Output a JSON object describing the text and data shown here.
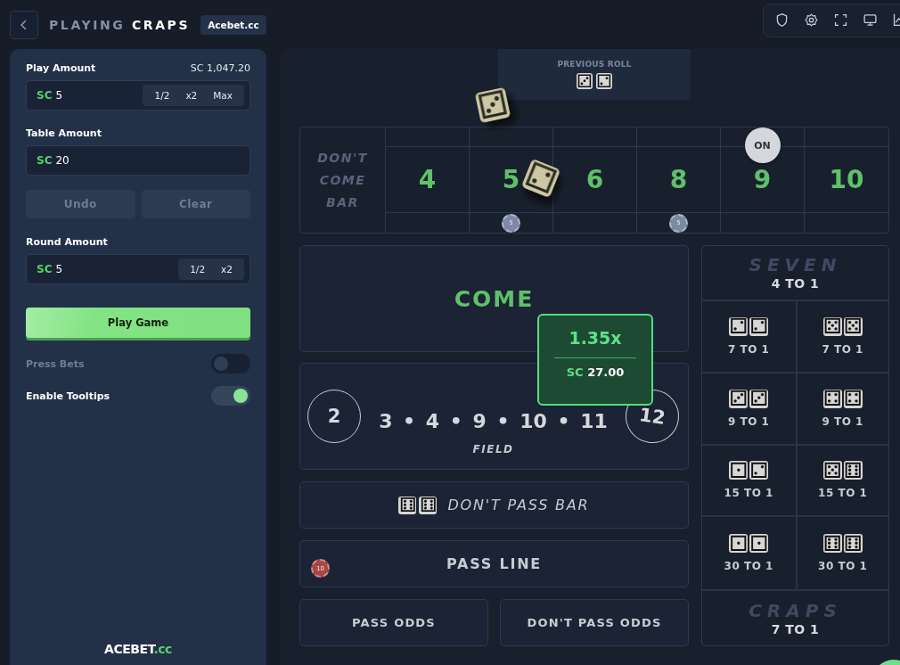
{
  "header": {
    "title_prefix": "PLAYING",
    "title": "CRAPS",
    "badge": "Acebet.cc"
  },
  "sidebar": {
    "play_amount": {
      "label": "Play Amount",
      "balance": "SC 1,047.20",
      "currency": "SC",
      "value": "5",
      "buttons": [
        "1/2",
        "x2",
        "Max"
      ]
    },
    "table_amount": {
      "label": "Table Amount",
      "currency": "SC",
      "value": "20"
    },
    "actions": [
      {
        "label": "Undo",
        "disabled": true
      },
      {
        "label": "Clear",
        "disabled": true
      }
    ],
    "round_amount": {
      "label": "Round Amount",
      "currency": "SC",
      "value": "5",
      "buttons": [
        "1/2",
        "x2"
      ]
    },
    "play_button": "Play Game",
    "toggles": [
      {
        "label": "Press Bets",
        "on": false,
        "disabled": true
      },
      {
        "label": "Enable Tooltips",
        "on": true,
        "disabled": false
      }
    ],
    "logo": {
      "name": "ACEBET",
      "suffix": ".cc"
    }
  },
  "previous_roll": {
    "label": "PREVIOUS ROLL",
    "dice": [
      "⚂",
      "⚁"
    ]
  },
  "rolling_dice": [
    "⚂",
    "⚁"
  ],
  "point_table": {
    "dont_come_bar": "DON'T COME BAR",
    "puck_label": "ON",
    "points": [
      {
        "number": "4",
        "on": false
      },
      {
        "number": "5",
        "on": false,
        "chip": {
          "value": "5",
          "color": "#7d8aa3"
        }
      },
      {
        "number": "6",
        "on": false
      },
      {
        "number": "8",
        "on": false,
        "chip": {
          "value": "5",
          "color": "#7d8aa3"
        }
      },
      {
        "number": "9",
        "on": true
      },
      {
        "number": "10",
        "on": false
      }
    ]
  },
  "come": "COME",
  "field": {
    "label": "FIELD",
    "numbers": "3 • 4 • 9 • 10 • 11",
    "circled": [
      "2",
      "12"
    ]
  },
  "dont_pass_bar": {
    "label": "DON'T PASS BAR",
    "dice": [
      "⚅",
      "⚅"
    ]
  },
  "pass_line": {
    "label": "PASS LINE",
    "chip": {
      "value": "10",
      "color": "#a94644"
    }
  },
  "odds": [
    "PASS ODDS",
    "DON'T PASS ODDS"
  ],
  "propositions": {
    "seven": {
      "watermark": "SEVEN",
      "payout": "4 TO 1"
    },
    "hardways": [
      {
        "dice": [
          "⚁",
          "⚁"
        ],
        "payout": "7 TO 1"
      },
      {
        "dice": [
          "⚄",
          "⚄"
        ],
        "payout": "7 TO 1"
      },
      {
        "dice": [
          "⚂",
          "⚂"
        ],
        "payout": "9 TO 1"
      },
      {
        "dice": [
          "⚃",
          "⚃"
        ],
        "payout": "9 TO 1"
      },
      {
        "dice": [
          "⚀",
          "⚁"
        ],
        "payout": "15 TO 1"
      },
      {
        "dice": [
          "⚄",
          "⚅"
        ],
        "payout": "15 TO 1"
      },
      {
        "dice": [
          "⚀",
          "⚀"
        ],
        "payout": "30 TO 1"
      },
      {
        "dice": [
          "⚅",
          "⚅"
        ],
        "payout": "30 TO 1"
      }
    ],
    "craps": {
      "watermark": "CRAPS",
      "payout": "7 TO 1"
    }
  },
  "tooltip": {
    "multiplier": "1.35x",
    "currency": "SC",
    "amount": "27.00"
  }
}
